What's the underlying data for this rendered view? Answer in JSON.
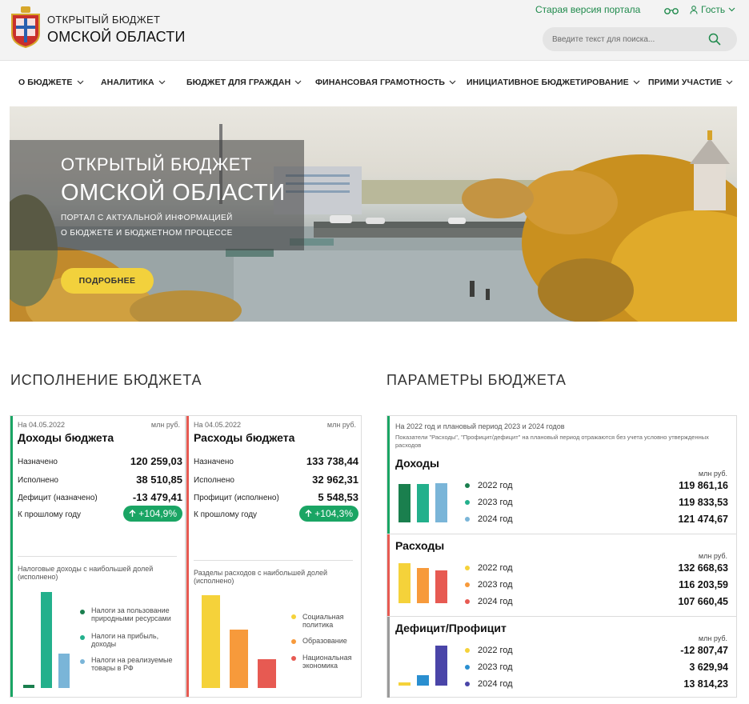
{
  "header": {
    "brand_top": "ОТКРЫТЫЙ БЮДЖЕТ",
    "brand_bottom": "ОМСКОЙ ОБЛАСТИ",
    "old_portal": "Старая версия портала",
    "guest": "Гость",
    "search_placeholder": "Введите текст для поиска..."
  },
  "nav": [
    {
      "label": "О БЮДЖЕТЕ"
    },
    {
      "label": "АНАЛИТИКА"
    },
    {
      "label": "БЮДЖЕТ ДЛЯ ГРАЖДАН"
    },
    {
      "label": "ФИНАНСОВАЯ ГРАМОТНОСТЬ"
    },
    {
      "label": "ИНИЦИАТИВНОЕ БЮДЖЕТИРОВАНИЕ"
    },
    {
      "label": "ПРИМИ УЧАСТИЕ"
    }
  ],
  "hero": {
    "title1": "ОТКРЫТЫЙ БЮДЖЕТ",
    "title2": "ОМСКОЙ ОБЛАСТИ",
    "sub1": "ПОРТАЛ С АКТУАЛЬНОЙ ИНФОРМАЦИЕЙ",
    "sub2": "О БЮДЖЕТЕ И БЮДЖЕТНОМ ПРОЦЕССЕ",
    "button": "ПОДРОБНЕЕ"
  },
  "sections": {
    "execution": "ИСПОЛНЕНИЕ БЮДЖЕТА",
    "params": "ПАРАМЕТРЫ БЮДЖЕТА"
  },
  "income": {
    "date": "На 04.05.2022",
    "unit": "млн руб.",
    "title": "Доходы бюджета",
    "rows": [
      {
        "label": "Назначено",
        "value": "120 259,03"
      },
      {
        "label": "Исполнено",
        "value": "38 510,85"
      },
      {
        "label": "Дефицит (назначено)",
        "value": "-13 479,41"
      }
    ],
    "prev_label": "К прошлому году",
    "prev_value": "+104,9%",
    "chart_caption": "Налоговые доходы с наибольшей долей (исполнено)",
    "legend": [
      {
        "label": "Налоги за пользование природными ресурсами",
        "color": "#1a7f4e"
      },
      {
        "label": "Налоги на прибыль, доходы",
        "color": "#23b08c"
      },
      {
        "label": "Налоги на реализуемые товары в РФ",
        "color": "#7ab5d8"
      }
    ],
    "bars": [
      0.03,
      1.0,
      0.36
    ]
  },
  "expense": {
    "date": "На 04.05.2022",
    "unit": "млн руб.",
    "title": "Расходы бюджета",
    "rows": [
      {
        "label": "Назначено",
        "value": "133 738,44"
      },
      {
        "label": "Исполнено",
        "value": "32 962,31"
      },
      {
        "label": "Профицит (исполнено)",
        "value": "5 548,53"
      }
    ],
    "prev_label": "К прошлому году",
    "prev_value": "+104,3%",
    "chart_caption": "Разделы расходов с наибольшей долей (исполнено)",
    "legend": [
      {
        "label": "Социальная политика",
        "color": "#f5d23a"
      },
      {
        "label": "Образование",
        "color": "#f79a3b"
      },
      {
        "label": "Национальная экономика",
        "color": "#e75a52"
      }
    ],
    "bars": [
      1.0,
      0.63,
      0.31
    ]
  },
  "params": {
    "head1": "На 2022 год и плановый период 2023 и 2024 годов",
    "head2": "Показатели \"Расходы\", \"Профицит/дефицит\" на плановый период отражаются без учета условно утвержденных расходов",
    "unit": "млн руб.",
    "blocks": [
      {
        "title": "Доходы",
        "accent": "#1aa564",
        "rows": [
          {
            "year": "2022 год",
            "value": "119 861,16",
            "color": "#1a7f4e"
          },
          {
            "year": "2023 год",
            "value": "119 833,53",
            "color": "#23b08c"
          },
          {
            "year": "2024 год",
            "value": "121 474,67",
            "color": "#7ab5d8"
          }
        ],
        "bars": [
          0.98,
          0.98,
          1.0
        ]
      },
      {
        "title": "Расходы",
        "accent": "#e75a52",
        "rows": [
          {
            "year": "2022 год",
            "value": "132 668,63",
            "color": "#f5d23a"
          },
          {
            "year": "2023 год",
            "value": "116 203,59",
            "color": "#f79a3b"
          },
          {
            "year": "2024 год",
            "value": "107 660,45",
            "color": "#e75a52"
          }
        ],
        "bars": [
          1.0,
          0.88,
          0.81
        ]
      },
      {
        "title": "Дефицит/Профицит",
        "accent": "#9a9a9a",
        "rows": [
          {
            "year": "2022 год",
            "value": "-12 807,47",
            "color": "#f5d23a"
          },
          {
            "year": "2023 год",
            "value": "3 629,94",
            "color": "#2a8fd0"
          },
          {
            "year": "2024 год",
            "value": "13 814,23",
            "color": "#4a45a8"
          }
        ],
        "bars": [
          0.07,
          0.26,
          1.0
        ]
      }
    ]
  }
}
